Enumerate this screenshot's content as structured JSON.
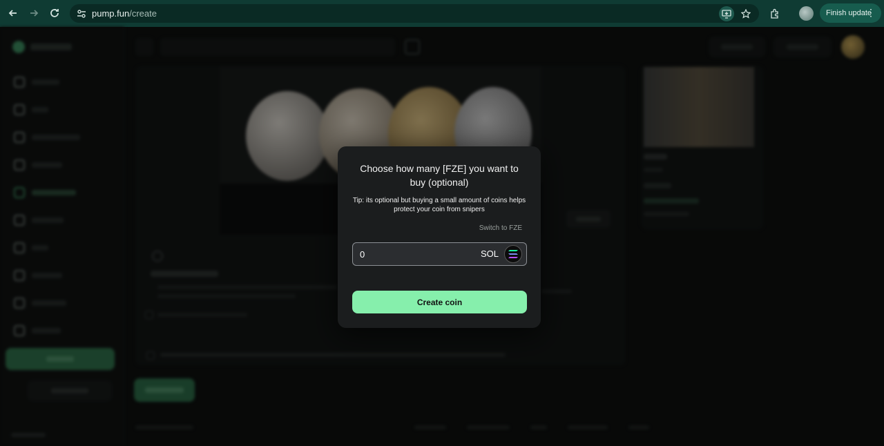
{
  "browser": {
    "url_host": "pump.fun",
    "url_path": "/create",
    "finish_update_label": "Finish update"
  },
  "modal": {
    "title": "Choose how many [FZE] you want to buy (optional)",
    "tip": "Tip: its optional but buying a small amount of coins helps protect your coin from snipers",
    "switch_label": "Switch to FZE",
    "amount_value": "0",
    "currency": "SOL",
    "create_button": "Create coin"
  },
  "colors": {
    "browser_chrome": "#0f3b33",
    "accent_green": "#86efac",
    "modal_bg": "#1b1d1e"
  }
}
